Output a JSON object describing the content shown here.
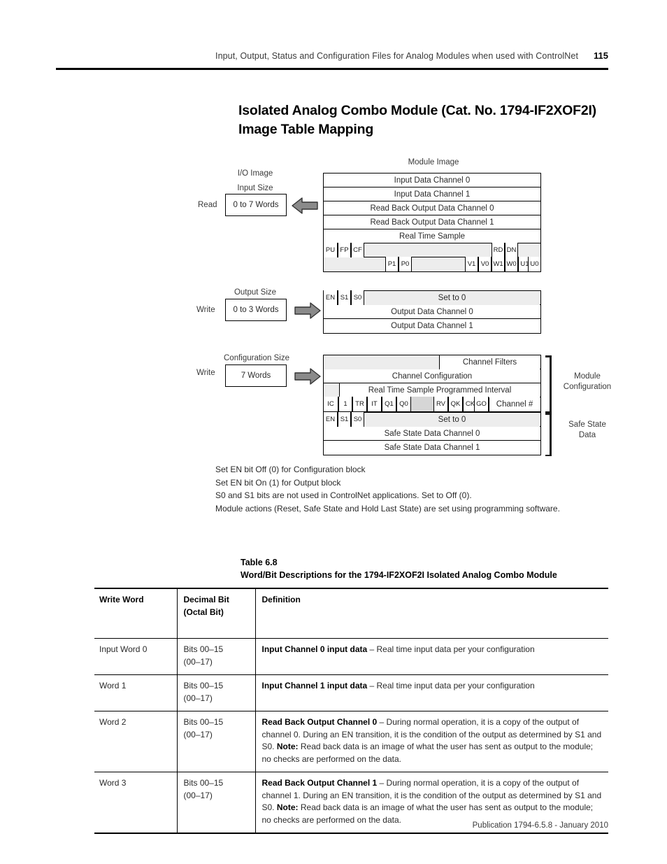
{
  "header": {
    "title": "Input, Output, Status and Configuration Files for Analog Modules when used with ControlNet",
    "page_number": "115"
  },
  "section": {
    "title": "Isolated Analog Combo Module (Cat. No. 1794-IF2XOF2I) Image Table Mapping"
  },
  "diagram": {
    "module_image_label": "Module Image",
    "io_image_label": "I/O Image",
    "input": {
      "direction": "Read",
      "size_label": "Input Size",
      "size_value": "0 to 7 Words",
      "arrow": "arrow-left",
      "rows": [
        "Input Data Channel 0",
        "Input Data Channel 1",
        "Read Back Output Data Channel 0",
        "Read Back Output Data Channel 1",
        "Real Time Sample"
      ],
      "bit_row_1": [
        "PU",
        "FP",
        "CF",
        "RD",
        "DN"
      ],
      "bit_row_2": [
        "P1",
        "P0",
        "V1",
        "V0",
        "W1",
        "W0",
        "U1",
        "U0"
      ]
    },
    "output": {
      "direction": "Write",
      "size_label": "Output Size",
      "size_value": "0 to 3 Words",
      "arrow": "arrow-right",
      "bit_cells": [
        "EN",
        "S1",
        "S0"
      ],
      "set_to_zero": "Set to 0",
      "rows": [
        "Output Data Channel 0",
        "Output Data Channel 1"
      ]
    },
    "configuration": {
      "direction": "Write",
      "size_label": "Configuration Size",
      "size_value": "7 Words",
      "arrow": "arrow-right",
      "channel_filters": "Channel Filters",
      "channel_configuration": "Channel Configuration",
      "real_time_sample": "Real Time Sample Programmed Interval",
      "config_bits": [
        "IC",
        "1",
        "TR",
        "IT",
        "Q1",
        "Q0",
        "RV",
        "QK",
        "CK",
        "GO"
      ],
      "channel_number": "Channel #",
      "safe_bits": [
        "EN",
        "S1",
        "S0"
      ],
      "set_to_zero": "Set to 0",
      "safe_rows": [
        "Safe State Data Channel 0",
        "Safe State Data Channel 1"
      ],
      "bracket_module": "Module\nConfiguration",
      "bracket_safe": "Safe State\nData"
    },
    "notes": [
      "Set EN bit Off (0) for Configuration block",
      "Set EN bit On (1) for Output block",
      "S0 and S1 bits are not used in ControlNet applications. Set to Off (0).",
      "Module actions (Reset, Safe State and Hold Last State) are set using programming software."
    ]
  },
  "table": {
    "caption_line1": "Table 6.8",
    "caption_line2": "Word/Bit Descriptions for the 1794-IF2XOF2I Isolated Analog Combo Module",
    "headers": [
      "Write Word",
      "Decimal Bit\n(Octal Bit)",
      "Definition"
    ],
    "rows": [
      {
        "word": "Input Word 0",
        "bits": "Bits 00–15\n(00–17)",
        "def_bold": "Input Channel 0 input data",
        "def_rest": " – Real time input data per your configuration",
        "def_note_label": "",
        "def_tail": ""
      },
      {
        "word": "Word 1",
        "bits": "Bits 00–15\n(00–17)",
        "def_bold": "Input Channel 1 input data",
        "def_rest": " – Real time input data per your configuration",
        "def_note_label": "",
        "def_tail": ""
      },
      {
        "word": "Word 2",
        "bits": "Bits 00–15\n(00–17)",
        "def_bold": "Read Back Output Channel 0",
        "def_rest": " – During normal operation, it is a copy of the output of channel 0. During an EN transition, it is the condition of the output as determined by S1 and S0. ",
        "def_note_label": "Note:",
        "def_tail": " Read back data is an image of what the user has sent as output to the module; no checks are performed on the data."
      },
      {
        "word": "Word 3",
        "bits": "Bits 00–15\n(00–17)",
        "def_bold": "Read Back Output Channel 1",
        "def_rest": " – During normal operation, it is a copy of the output of channel 1. During an EN transition, it is the condition of the output as determined by S1 and S0. ",
        "def_note_label": "Note:",
        "def_tail": " Read back data is an image of what the user has sent as output to the module; no checks are performed on the data."
      }
    ]
  },
  "footer": {
    "publication": "Publication 1794-6.5.8 - January 2010"
  }
}
